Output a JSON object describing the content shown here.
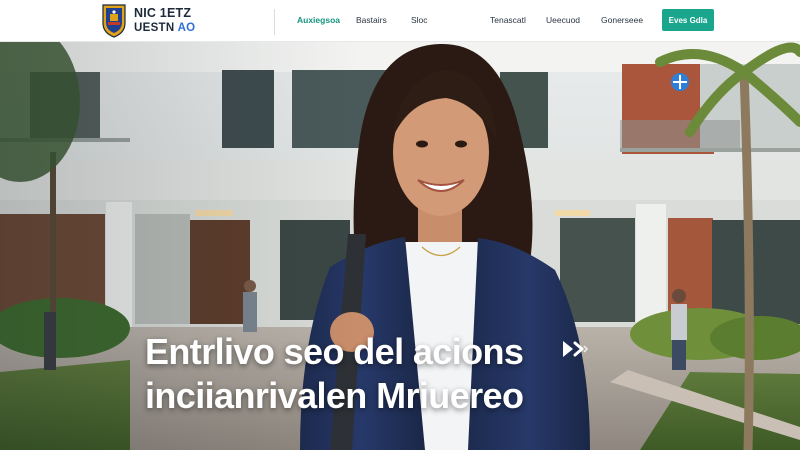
{
  "header": {
    "logo_icon": "university-crest-icon",
    "brand_line1": "NIC 1ETZ",
    "brand_line2_main": "UESTN",
    "brand_line2_accent": "AO",
    "nav_left": [
      {
        "label": "Auxiegsoa",
        "active": true
      },
      {
        "label": "Bastairs",
        "active": false
      },
      {
        "label": "Sloc",
        "active": false
      }
    ],
    "nav_right": [
      {
        "label": "Tenascatl",
        "active": false
      },
      {
        "label": "Ueecuod",
        "active": false
      },
      {
        "label": "Gonerseee",
        "active": false
      }
    ],
    "cta_label": "Eves Gdla"
  },
  "hero": {
    "title_line1": "Entrlivo seo del acions",
    "title_line2": "inciianrivalen Mriuereo",
    "arrow_icon": "arrow-right-icon",
    "badge_icon": "plus-badge-icon"
  },
  "colors": {
    "accent": "#1aa58d",
    "brand_dark": "#1c2a3a",
    "brand_blue": "#2f6fd6"
  }
}
